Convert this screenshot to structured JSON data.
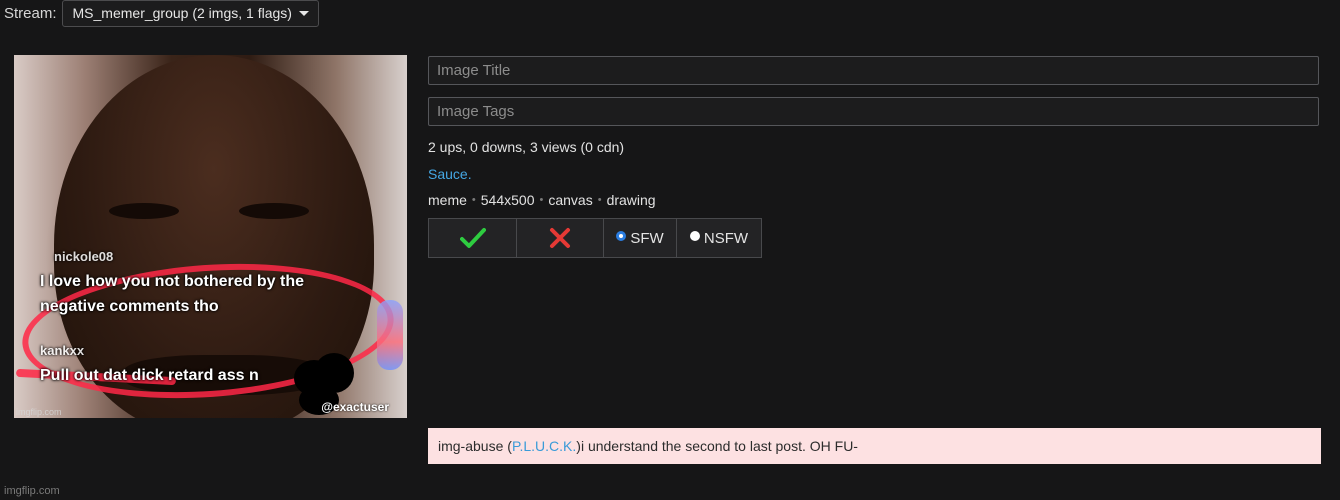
{
  "header": {
    "stream_label": "Stream:",
    "stream_selected": "MS_memer_group (2 imgs, 1 flags)"
  },
  "image": {
    "caption_user1": "nickole08",
    "caption_line1": "I love how you not bothered by the",
    "caption_line2": "negative comments tho",
    "caption_user2": "kankxx",
    "caption_line3": "Pull out dat dick retard ass n",
    "caption_tag": "@exactuser",
    "watermark": "imgflip.com"
  },
  "form": {
    "title_placeholder": "Image Title",
    "tags_placeholder": "Image Tags"
  },
  "meta": {
    "stats": "2 ups, 0 downs, 3 views (0 cdn)",
    "sauce_link": "Sauce.",
    "tags": [
      "meme",
      "544x500",
      "canvas",
      "drawing"
    ]
  },
  "moderation": {
    "approve_icon": "check-icon",
    "disapprove_icon": "x-icon",
    "sfw_label": "SFW",
    "nsfw_label": "NSFW",
    "selected": "SFW",
    "colors": {
      "approve": "#2ecc40",
      "disapprove": "#e53935"
    }
  },
  "comment": {
    "user": "img-abuse",
    "mention": "P.L.U.C.K.",
    "text": " i understand the second to last post. OH FU-"
  },
  "footer": {
    "watermark": "imgflip.com"
  }
}
